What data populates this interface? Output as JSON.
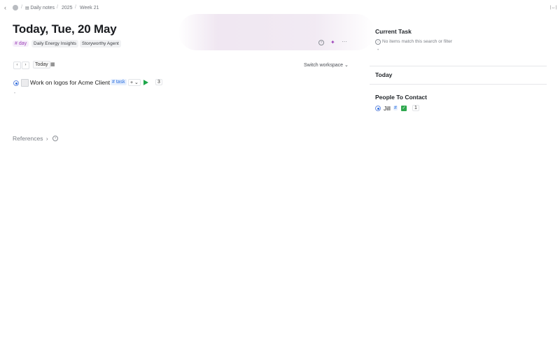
{
  "topbar": {
    "back": "‹",
    "workspace_initial": "",
    "breadcrumbs": [
      "Daily notes",
      "2025",
      "Week 21"
    ],
    "sidebar_toggle": "|↔|"
  },
  "page": {
    "title": "Today, Tue, 20 May",
    "tag_day": "# day",
    "chips": [
      "Daily Energy Insights",
      "Storyworthy Agent"
    ],
    "tools": {
      "help": "?",
      "sparkle": "✦",
      "more": "···"
    }
  },
  "nav": {
    "prev": "‹",
    "next": "›",
    "today": "Today",
    "calendar": "▦",
    "switch_workspace": "Switch workspace",
    "switch_chevron": "⌄"
  },
  "task": {
    "text": "Work on logos for Acme Client",
    "tag": "# task",
    "add": "+ ⌄",
    "count": "3"
  },
  "empty_bullet": "•",
  "references": {
    "label": "References",
    "chevron": "›",
    "help": "?"
  },
  "right_panel": {
    "current_task_title": "Current Task",
    "no_items": "No items match this search or filter",
    "info": "i",
    "dot": "•",
    "today_title": "Today",
    "people_title": "People To Contact",
    "person_name": "Jill",
    "person_hash": "#",
    "person_check": "✓",
    "person_count": "1"
  },
  "colors": {
    "accent_blue": "#2f6fe0",
    "tag_purple": "#9b3fb8",
    "play_green": "#1ea64a",
    "check_green": "#2fa84f"
  }
}
